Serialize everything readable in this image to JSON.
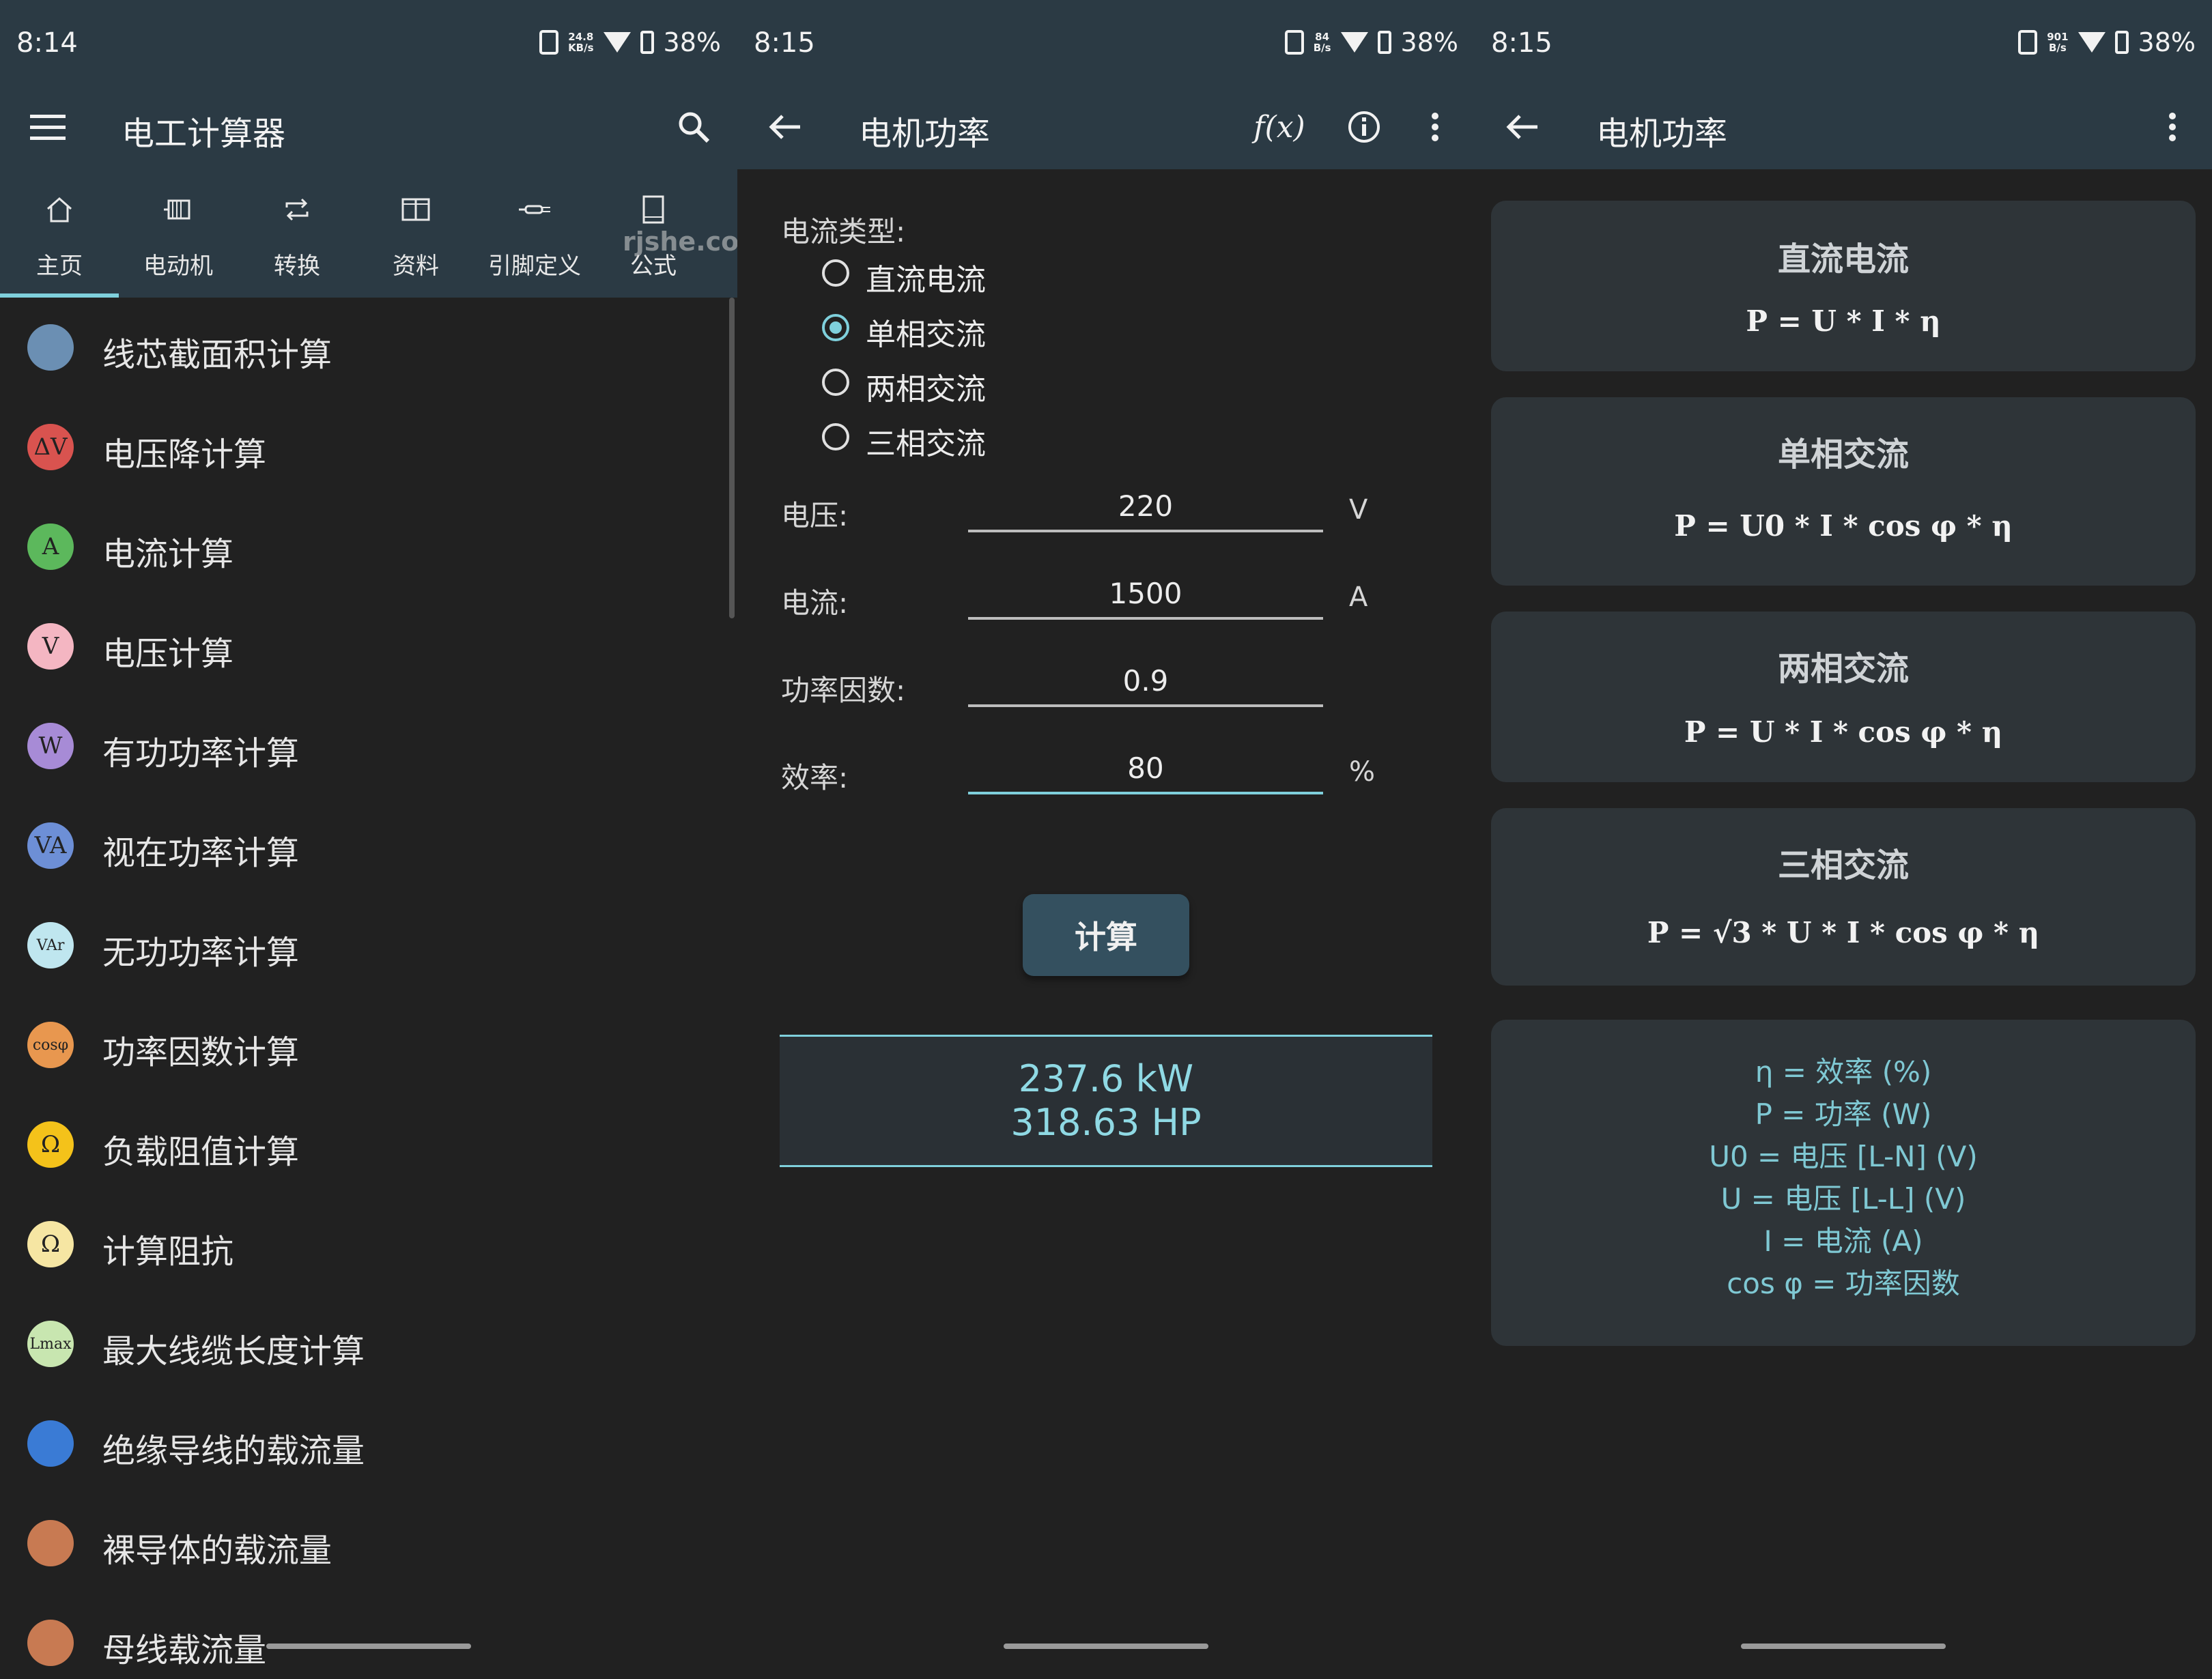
{
  "panels": [
    {
      "time": "8:14",
      "speed": [
        "24.8",
        "KB/s"
      ],
      "battery": "38%",
      "title": "电工计算器",
      "tabs": [
        {
          "label": "主页",
          "icon": "home-icon"
        },
        {
          "label": "电动机",
          "icon": "motor-icon"
        },
        {
          "label": "转换",
          "icon": "repeat-icon"
        },
        {
          "label": "资料",
          "icon": "book-open-icon"
        },
        {
          "label": "引脚定义",
          "icon": "connector-icon"
        },
        {
          "label": "公式",
          "icon": "notebook-icon"
        }
      ],
      "watermark": "rjshe.com",
      "items": [
        {
          "label": "线芯截面积计算",
          "glyph": "",
          "color": "#6b8fb3"
        },
        {
          "label": "电压降计算",
          "glyph": "ΔV",
          "color": "#d9534f"
        },
        {
          "label": "电流计算",
          "glyph": "A",
          "color": "#5cb85c"
        },
        {
          "label": "电压计算",
          "glyph": "V",
          "color": "#f4b6c2"
        },
        {
          "label": "有功功率计算",
          "glyph": "W",
          "color": "#a78bd6"
        },
        {
          "label": "视在功率计算",
          "glyph": "VA",
          "color": "#6d8fd6"
        },
        {
          "label": "无功功率计算",
          "glyph": "VAr",
          "color": "#bfe6ef"
        },
        {
          "label": "功率因数计算",
          "glyph": "cosφ",
          "color": "#e8974f"
        },
        {
          "label": "负载阻值计算",
          "glyph": "Ω",
          "color": "#f4c21a"
        },
        {
          "label": "计算阻抗",
          "glyph": "Ω",
          "color": "#f6e6a3"
        },
        {
          "label": "最大线缆长度计算",
          "glyph": "Lmax",
          "color": "#c8e6b0"
        },
        {
          "label": "绝缘导线的载流量",
          "glyph": "",
          "color": "#3a7bd5"
        },
        {
          "label": "裸导体的载流量",
          "glyph": "",
          "color": "#c87a52"
        },
        {
          "label": "母线载流量",
          "glyph": "",
          "color": "#c87a52"
        }
      ]
    },
    {
      "time": "8:15",
      "speed": [
        "84",
        "B/s"
      ],
      "battery": "38%",
      "title": "电机功率",
      "fx": "f(x)",
      "current_type_label": "电流类型:",
      "options": [
        "直流电流",
        "单相交流",
        "两相交流",
        "三相交流"
      ],
      "selected": "单相交流",
      "fields": [
        {
          "label": "电压:",
          "value": "220",
          "unit": "V"
        },
        {
          "label": "电流:",
          "value": "1500",
          "unit": "A"
        },
        {
          "label": "功率因数:",
          "value": "0.9",
          "unit": ""
        },
        {
          "label": "效率:",
          "value": "80",
          "unit": "%"
        }
      ],
      "button": "计算",
      "result": [
        "237.6 kW",
        "318.63 HP"
      ]
    },
    {
      "time": "8:15",
      "speed": [
        "901",
        "B/s"
      ],
      "battery": "38%",
      "title": "电机功率",
      "cards": [
        {
          "title": "直流电流",
          "formula": "P = U * I * η"
        },
        {
          "title": "单相交流",
          "formula": "P =  U0 * I * cos φ * η"
        },
        {
          "title": "两相交流",
          "formula": "P = U * I * cos φ * η"
        },
        {
          "title": "三相交流",
          "formula": "P =  √3  * U * I * cos φ * η"
        }
      ],
      "legend": [
        "η = 效率 (%)",
        "P = 功率 (W)",
        "U0 = 电压 [L-N] (V)",
        "U = 电压 [L-L] (V)",
        "I = 电流 (A)",
        "cos φ = 功率因数"
      ]
    }
  ]
}
